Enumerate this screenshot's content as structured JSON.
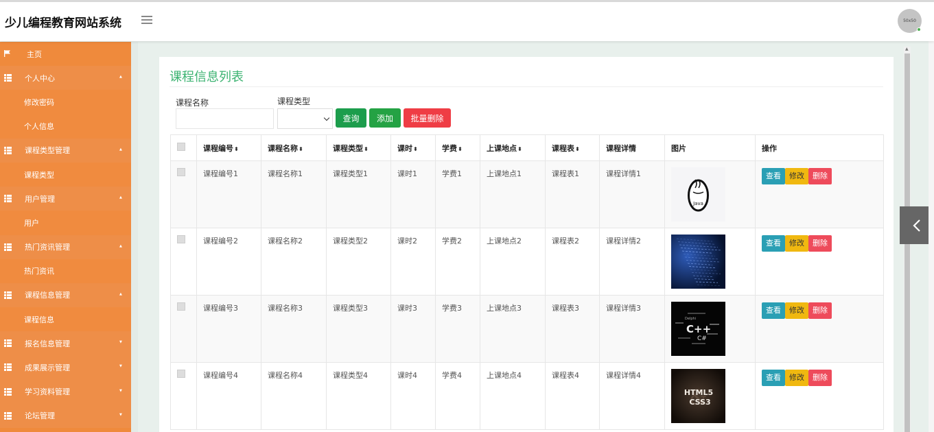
{
  "app": {
    "title": "少儿编程教育网站系统",
    "avatar_text": "50x50"
  },
  "sidebar": {
    "items": [
      {
        "label": "主页",
        "kind": "top",
        "icon": "flag-icon"
      },
      {
        "label": "个人中心",
        "kind": "main",
        "icon": "grid-icon",
        "expanded": true
      },
      {
        "label": "修改密码",
        "kind": "sub"
      },
      {
        "label": "个人信息",
        "kind": "sub"
      },
      {
        "label": "课程类型管理",
        "kind": "main",
        "icon": "grid-icon",
        "expanded": true
      },
      {
        "label": "课程类型",
        "kind": "sub"
      },
      {
        "label": "用户管理",
        "kind": "main",
        "icon": "grid-icon",
        "expanded": true
      },
      {
        "label": "用户",
        "kind": "sub"
      },
      {
        "label": "热门资讯管理",
        "kind": "main",
        "icon": "grid-icon",
        "expanded": true
      },
      {
        "label": "热门资讯",
        "kind": "sub"
      },
      {
        "label": "课程信息管理",
        "kind": "main",
        "icon": "grid-icon",
        "expanded": true
      },
      {
        "label": "课程信息",
        "kind": "sub"
      },
      {
        "label": "报名信息管理",
        "kind": "main",
        "icon": "grid-icon",
        "expanded": false
      },
      {
        "label": "成果展示管理",
        "kind": "main",
        "icon": "grid-icon",
        "expanded": false
      },
      {
        "label": "学习资料管理",
        "kind": "main",
        "icon": "grid-icon",
        "expanded": false
      },
      {
        "label": "论坛管理",
        "kind": "main",
        "icon": "grid-icon",
        "expanded": false
      }
    ]
  },
  "main": {
    "title": "课程信息列表",
    "search": {
      "name_label": "课程名称",
      "name_value": "",
      "type_label": "课程类型",
      "type_selected": ""
    },
    "buttons": {
      "query": "查询",
      "add": "添加",
      "batch_delete": "批量删除"
    },
    "table": {
      "headers": [
        "课程编号",
        "课程名称",
        "课程类型",
        "课时",
        "学费",
        "上课地点",
        "课程表",
        "课程详情",
        "图片",
        "操作"
      ],
      "sortable": [
        true,
        true,
        true,
        true,
        true,
        true,
        true,
        false,
        false,
        false
      ],
      "rows": [
        {
          "cells": [
            "课程编号1",
            "课程名称1",
            "课程类型1",
            "课时1",
            "学费1",
            "上课地点1",
            "课程表1",
            "课程详情1"
          ],
          "image": "java-logo"
        },
        {
          "cells": [
            "课程编号2",
            "课程名称2",
            "课程类型2",
            "课时2",
            "学费2",
            "上课地点2",
            "课程表2",
            "课程详情2"
          ],
          "image": "code-screen"
        },
        {
          "cells": [
            "课程编号3",
            "课程名称3",
            "课程类型3",
            "课时3",
            "学费3",
            "上课地点3",
            "课程表3",
            "课程详情3"
          ],
          "image": "cpp-wordcloud"
        },
        {
          "cells": [
            "课程编号4",
            "课程名称4",
            "课程类型4",
            "课时4",
            "学费4",
            "上课地点4",
            "课程表4",
            "课程详情4"
          ],
          "image": "html5-css3"
        }
      ],
      "actions": {
        "view": "查看",
        "edit": "修改",
        "delete": "删除"
      }
    }
  },
  "images": {
    "java-logo": {
      "text": "Java"
    },
    "cpp-wordcloud": {
      "text1": "C++",
      "text2": "C#",
      "text3": "Delphi"
    },
    "html5-css3": {
      "text1": "HTML5",
      "text2": "CSS3"
    }
  },
  "colors": {
    "sidebar": "#ef8a3c",
    "title_green": "#3cb371",
    "query": "#1c9d4c",
    "add": "#24a244",
    "batch_delete": "#ef3d45",
    "view": "#2a9fb4",
    "edit": "#f0b810",
    "delete": "#ee4b5b"
  }
}
